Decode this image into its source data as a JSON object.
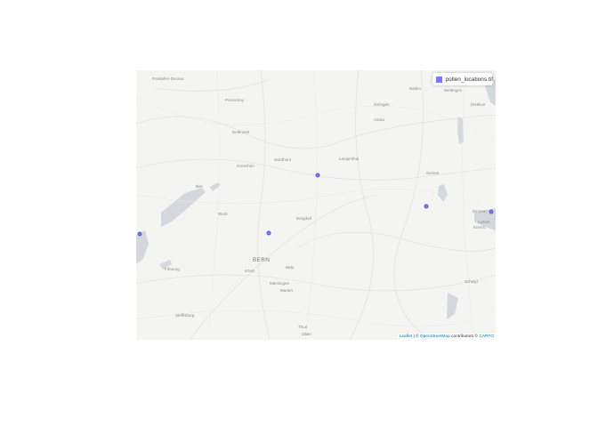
{
  "legend": {
    "label": "pollen_locations.tif",
    "color": "#7777ff"
  },
  "attribution": {
    "leaflet": "Leaflet",
    "separator": " | © ",
    "osm": "OpenStreetMap",
    "contrib": " contributors © ",
    "carto": "CARTO"
  },
  "places": [
    {
      "name": "Pontarlier-Dessus"
    },
    {
      "name": "Porrentruy"
    },
    {
      "name": "Delémont"
    },
    {
      "name": "Moutier"
    },
    {
      "name": "Grenchen"
    },
    {
      "name": "Solothurn"
    },
    {
      "name": "Langenthal"
    },
    {
      "name": "Neuchâtel"
    },
    {
      "name": "Biel"
    },
    {
      "name": "Burgdorf"
    },
    {
      "name": "BERN"
    },
    {
      "name": "Köniz"
    },
    {
      "name": "Worb"
    },
    {
      "name": "Belp"
    },
    {
      "name": "Münsingen"
    },
    {
      "name": "Murten"
    },
    {
      "name": "Fribourg"
    },
    {
      "name": "Steffisburg"
    },
    {
      "name": "Thun"
    },
    {
      "name": "Olten"
    },
    {
      "name": "Zofingen"
    },
    {
      "name": "Aarau"
    },
    {
      "name": "Baden"
    },
    {
      "name": "Wettingen"
    },
    {
      "name": "Dietikon"
    },
    {
      "name": "Sursee"
    },
    {
      "name": "Emmen"
    },
    {
      "name": "Luzern"
    },
    {
      "name": "Kriens"
    },
    {
      "name": "Schwyz"
    }
  ],
  "markers": [
    {
      "name": "marker-1"
    },
    {
      "name": "marker-2"
    },
    {
      "name": "marker-3"
    },
    {
      "name": "marker-4"
    },
    {
      "name": "marker-5"
    }
  ]
}
